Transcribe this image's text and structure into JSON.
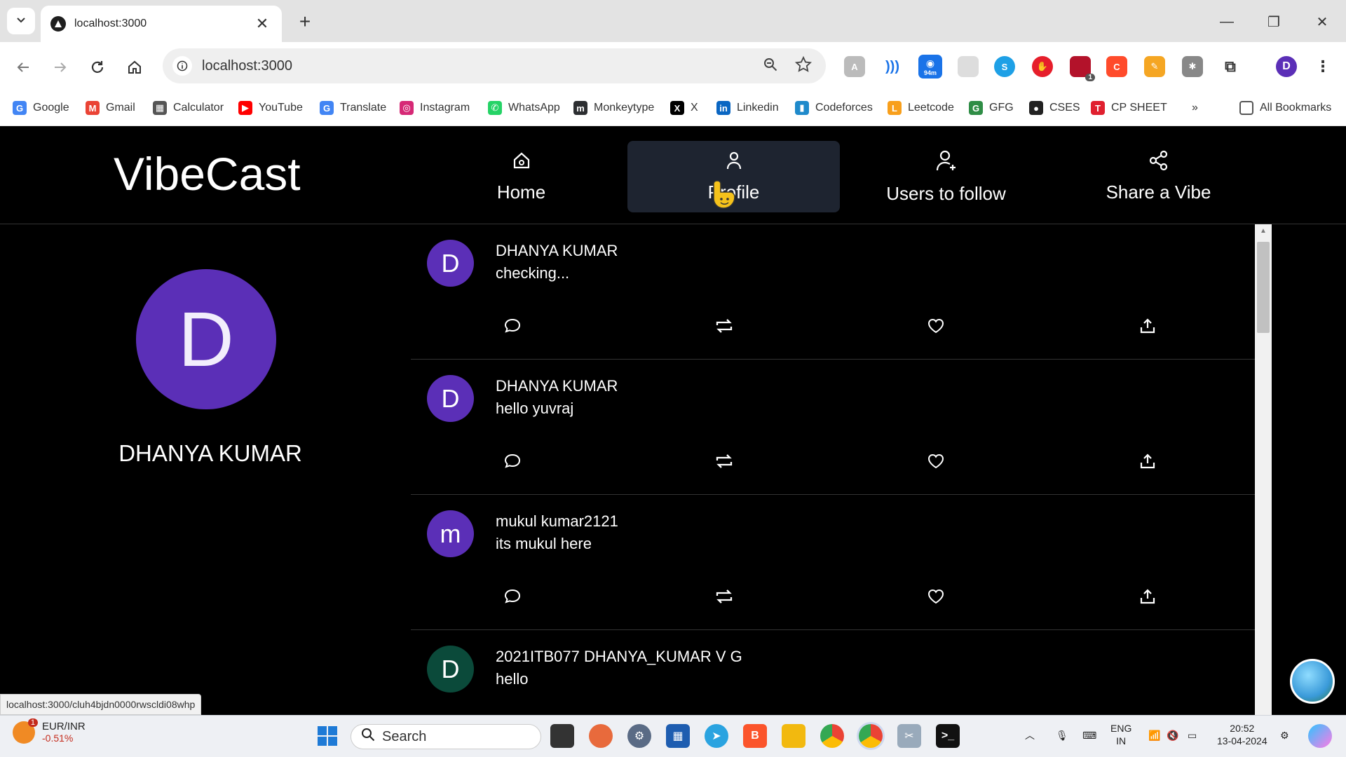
{
  "browser": {
    "tab_title": "localhost:3000",
    "url": "localhost:3000",
    "extensions_badge_time": "94m",
    "extensions_badge_count": "1",
    "profile_initial": "D",
    "bookmarks": [
      {
        "label": "Google",
        "color": "#4285f4",
        "glyph": "G"
      },
      {
        "label": "Gmail",
        "color": "#ea4335",
        "glyph": "M"
      },
      {
        "label": "Calculator",
        "color": "#555555",
        "glyph": "▦"
      },
      {
        "label": "YouTube",
        "color": "#ff0000",
        "glyph": "▶"
      },
      {
        "label": "Translate",
        "color": "#4285f4",
        "glyph": "G"
      },
      {
        "label": "Instagram",
        "color": "#d62976",
        "glyph": "◎"
      },
      {
        "label": "WhatsApp",
        "color": "#25d366",
        "glyph": "✆"
      },
      {
        "label": "Monkeytype",
        "color": "#2c2e31",
        "glyph": "m"
      },
      {
        "label": "X",
        "color": "#000000",
        "glyph": "X"
      },
      {
        "label": "Linkedin",
        "color": "#0a66c2",
        "glyph": "in"
      },
      {
        "label": "Codeforces",
        "color": "#1f8acb",
        "glyph": "▮"
      },
      {
        "label": "Leetcode",
        "color": "#f89f1b",
        "glyph": "L"
      },
      {
        "label": "GFG",
        "color": "#2f8d46",
        "glyph": "G"
      },
      {
        "label": "CSES",
        "color": "#222222",
        "glyph": "●"
      },
      {
        "label": "CP SHEET",
        "color": "#e0202f",
        "glyph": "T"
      }
    ],
    "all_bookmarks": "All Bookmarks",
    "status_url": "localhost:3000/cluh4bjdn0000rwscldi08whp"
  },
  "app": {
    "logo": "VibeCast",
    "nav": [
      {
        "label": "Home",
        "icon": "home-icon"
      },
      {
        "label": "Profile",
        "icon": "user-icon"
      },
      {
        "label": "Users to follow",
        "icon": "user-plus-icon"
      },
      {
        "label": "Share a Vibe",
        "icon": "share-icon"
      }
    ],
    "profile": {
      "initial": "D",
      "name": "DHANYA KUMAR"
    },
    "posts": [
      {
        "initial": "D",
        "author": "DHANYA KUMAR",
        "text": "checking...",
        "avatar_color": "#5b2fb7"
      },
      {
        "initial": "D",
        "author": "DHANYA KUMAR",
        "text": "hello yuvraj",
        "avatar_color": "#5b2fb7"
      },
      {
        "initial": "m",
        "author": "mukul kumar2121",
        "text": "its mukul here",
        "avatar_color": "#5b2fb7"
      },
      {
        "initial": "D",
        "author": "2021ITB077 DHANYA_KUMAR V G",
        "text": "hello",
        "avatar_color": "#0b4a3a"
      }
    ]
  },
  "taskbar": {
    "ticker_pair": "EUR/INR",
    "ticker_change": "-0.51%",
    "ticker_badge": "1",
    "search_label": "Search",
    "lang_top": "ENG",
    "lang_bottom": "IN",
    "time": "20:52",
    "date": "13-04-2024"
  }
}
